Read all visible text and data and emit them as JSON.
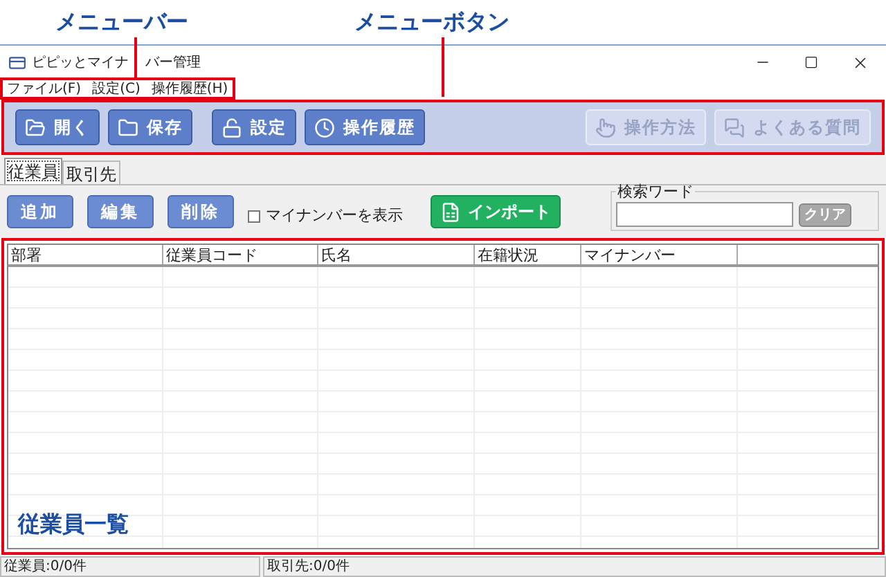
{
  "annotations": [
    {
      "label": "メニューバー"
    },
    {
      "label": "メニューボタン"
    }
  ],
  "window": {
    "title_parts": [
      "ピピッとマイナ",
      "バー管理"
    ]
  },
  "menu": [
    "ファイル(F)",
    "設定(C)",
    "操作履歴(H)"
  ],
  "toolbar": [
    {
      "label": "開く",
      "disabled": false
    },
    {
      "label": "保存",
      "disabled": false
    },
    {
      "label": "設定",
      "disabled": false
    },
    {
      "label": "操作履歴",
      "disabled": false
    },
    {
      "label": "操作方法",
      "disabled": true
    },
    {
      "label": "よくある質問",
      "disabled": true
    }
  ],
  "tabs": [
    {
      "label": "従業員",
      "selected": true
    },
    {
      "label": "取引先",
      "selected": false
    }
  ],
  "actions": [
    "追加",
    "編集",
    "削除"
  ],
  "show_mynumber": {
    "label": "マイナンバーを表示",
    "checked": false
  },
  "import_button": "インポート",
  "search": {
    "legend": "検索ワード",
    "clear": "クリア"
  },
  "table": {
    "columns": [
      "部署",
      "従業員コード",
      "氏名",
      "在籍状況",
      "マイナンバー"
    ]
  },
  "overlay_label": "従業員一覧",
  "status_bar": [
    "従業員:0/0件",
    "取引先:0/0件"
  ]
}
